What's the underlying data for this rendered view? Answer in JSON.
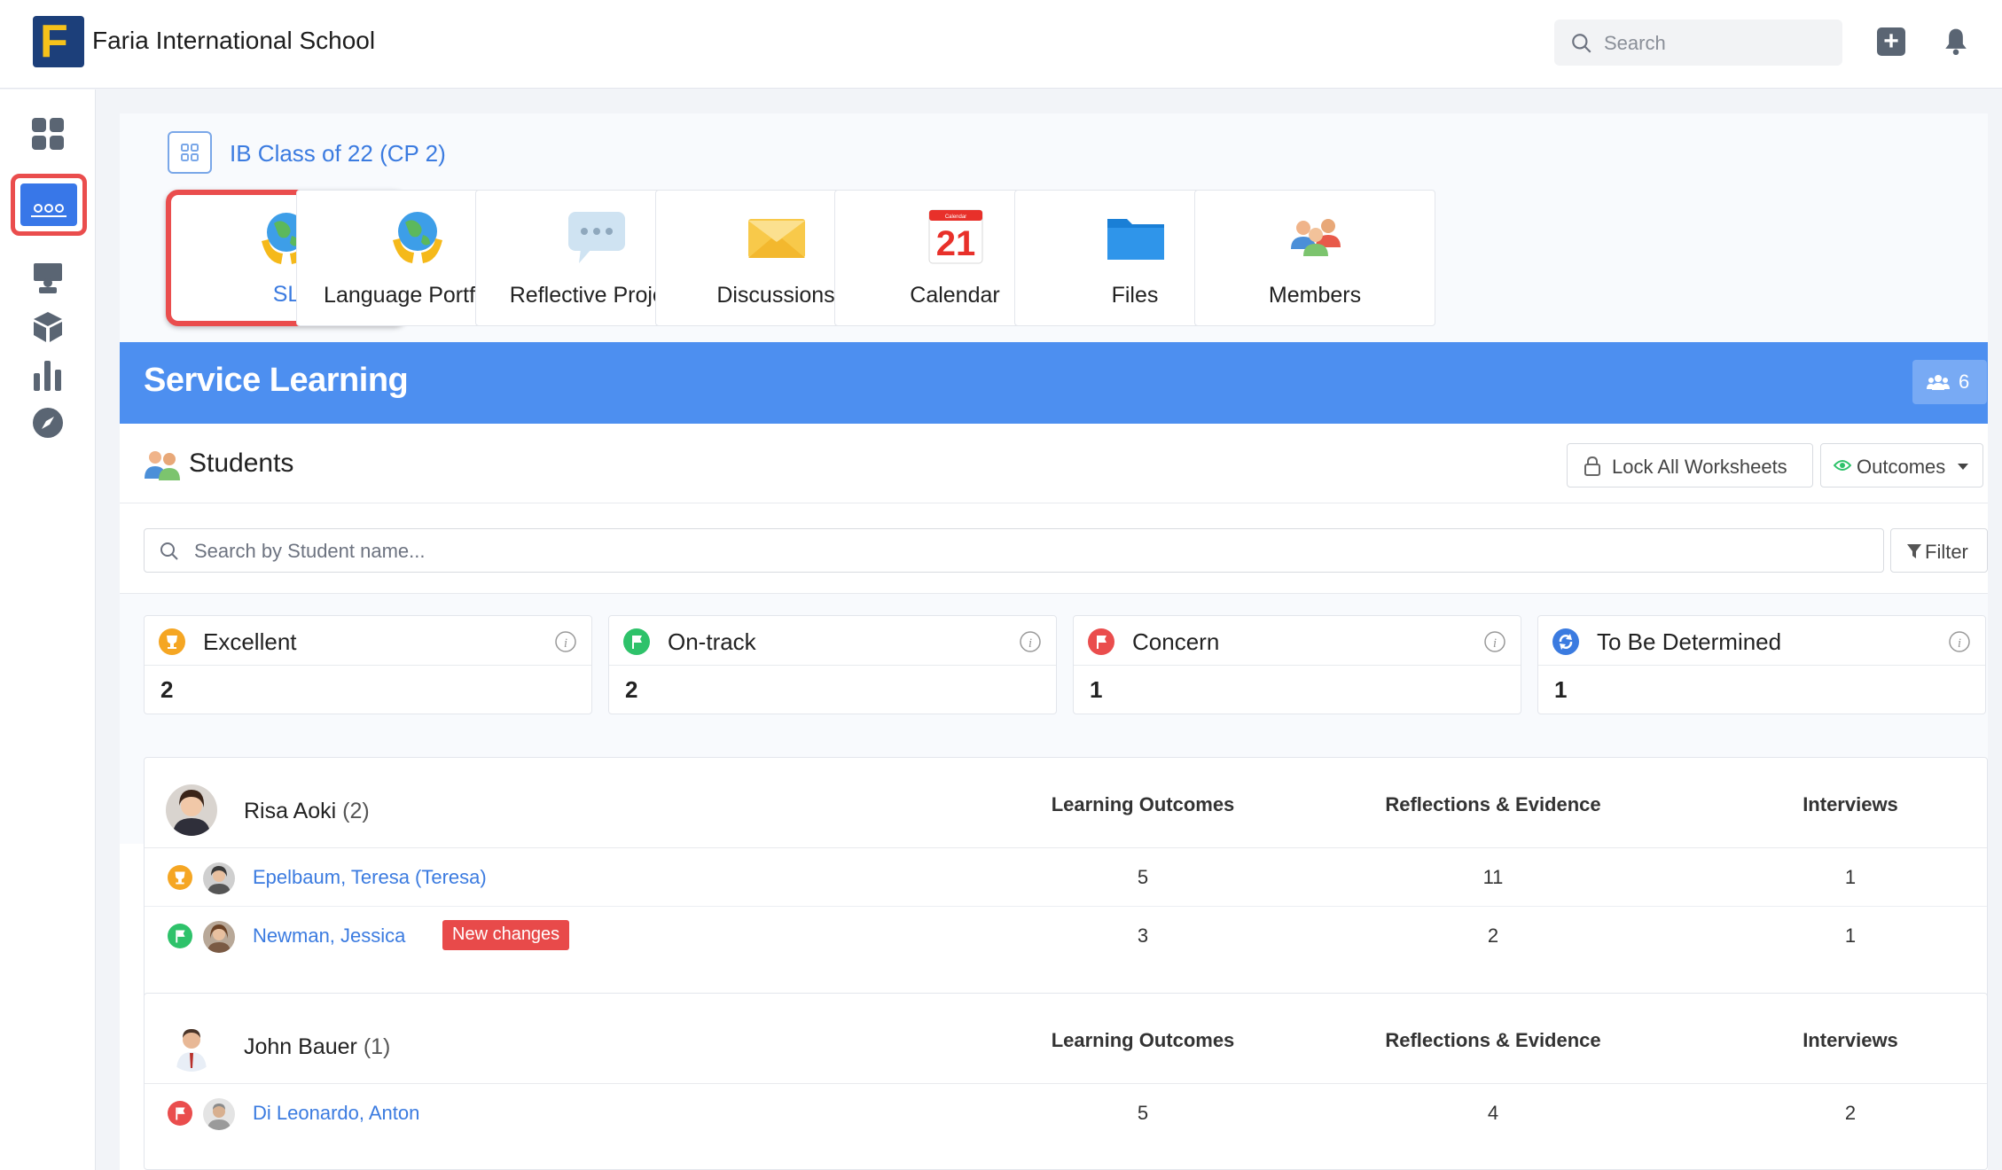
{
  "header": {
    "school_name": "Faria International School",
    "logo_letter": "F",
    "search_placeholder": "Search"
  },
  "sidebar": {
    "items": [
      {
        "name": "dashboard",
        "active": false
      },
      {
        "name": "classes",
        "active": true
      },
      {
        "name": "teaching",
        "active": false
      },
      {
        "name": "units",
        "active": false
      },
      {
        "name": "reports",
        "active": false
      },
      {
        "name": "explore",
        "active": false
      }
    ]
  },
  "class": {
    "title": "IB Class of 22 (CP 2)",
    "tiles": [
      {
        "label": "SL",
        "icon": "globe-hands-icon",
        "active": true
      },
      {
        "label": "Language Portfolio",
        "icon": "globe-hands-icon",
        "active": false
      },
      {
        "label": "Reflective Project",
        "icon": "speech-bubble-icon",
        "active": false
      },
      {
        "label": "Discussions",
        "icon": "envelope-icon",
        "active": false
      },
      {
        "label": "Calendar",
        "icon": "calendar-icon",
        "active": false,
        "day": "21",
        "caption": "Calendar"
      },
      {
        "label": "Files",
        "icon": "folder-icon",
        "active": false
      },
      {
        "label": "Members",
        "icon": "people-icon",
        "active": false
      }
    ]
  },
  "banner": {
    "title": "Service Learning",
    "member_count": "6"
  },
  "students": {
    "title": "Students",
    "lock_label": "Lock All Worksheets",
    "outcomes_label": "Outcomes",
    "search_placeholder": "Search by Student name...",
    "filter_label": "Filter"
  },
  "stats": [
    {
      "label": "Excellent",
      "count": "2",
      "color": "#f5a623",
      "icon": "trophy-icon"
    },
    {
      "label": "On-track",
      "count": "2",
      "color": "#2ec26a",
      "icon": "flag-icon"
    },
    {
      "label": "Concern",
      "count": "1",
      "color": "#ea4d4d",
      "icon": "flag-icon"
    },
    {
      "label": "To Be Determined",
      "count": "1",
      "color": "#3b7be0",
      "icon": "refresh-icon"
    }
  ],
  "columns": {
    "outcomes": "Learning Outcomes",
    "reflections": "Reflections & Evidence",
    "interviews": "Interviews"
  },
  "groups": [
    {
      "advisor": "Risa Aoki",
      "count": "(2)",
      "students": [
        {
          "name": "Epelbaum, Teresa (Teresa)",
          "status": "excellent",
          "badge": "",
          "outcomes": "5",
          "reflections": "11",
          "interviews": "1"
        },
        {
          "name": "Newman, Jessica",
          "status": "on-track",
          "badge": "New changes",
          "outcomes": "3",
          "reflections": "2",
          "interviews": "1"
        }
      ]
    },
    {
      "advisor": "John Bauer",
      "count": "(1)",
      "students": [
        {
          "name": "Di Leonardo, Anton",
          "status": "concern",
          "badge": "",
          "outcomes": "5",
          "reflections": "4",
          "interviews": "2"
        }
      ]
    }
  ]
}
